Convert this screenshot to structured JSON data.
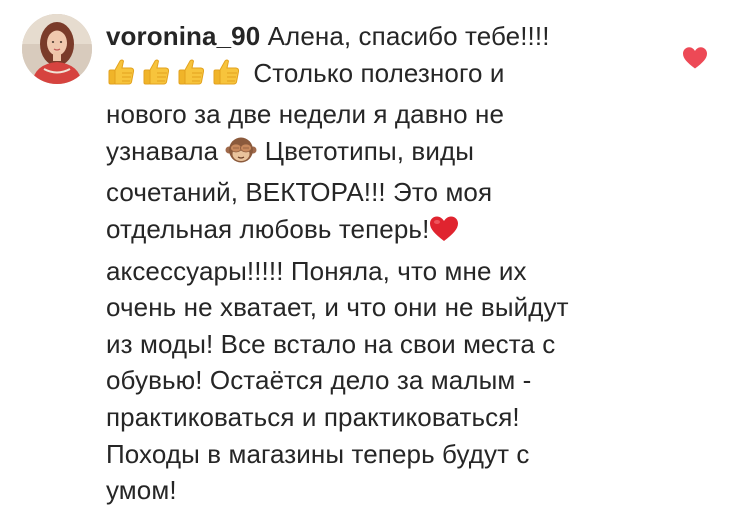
{
  "comment": {
    "username": "voronina_90",
    "lines": [
      " Алена, спасибо тебе!!!!",
      " Столько полезного и",
      "нового за две недели я давно не",
      "узнавала",
      " Цветотипы,  виды",
      "сочетаний, ВЕКТОРА!!! Это моя",
      "отдельная любовь теперь!",
      "аксессуары!!!!! Поняла, что мне их",
      "очень не хватает, и что они не выйдут",
      "из моды! Все встало на свои места с",
      "обувью! Остаётся дело за малым -",
      "практиковаться и практиковаться!",
      "Походы в магазины теперь будут с",
      "умом!"
    ],
    "emojis": {
      "thumbs_up": "thumbs-up-icon",
      "see_no_evil": "see-no-evil-monkey-icon",
      "heart": "red-heart-icon"
    }
  },
  "actions": {
    "like_icon": "heart-icon",
    "like_color": "#ed4956"
  }
}
